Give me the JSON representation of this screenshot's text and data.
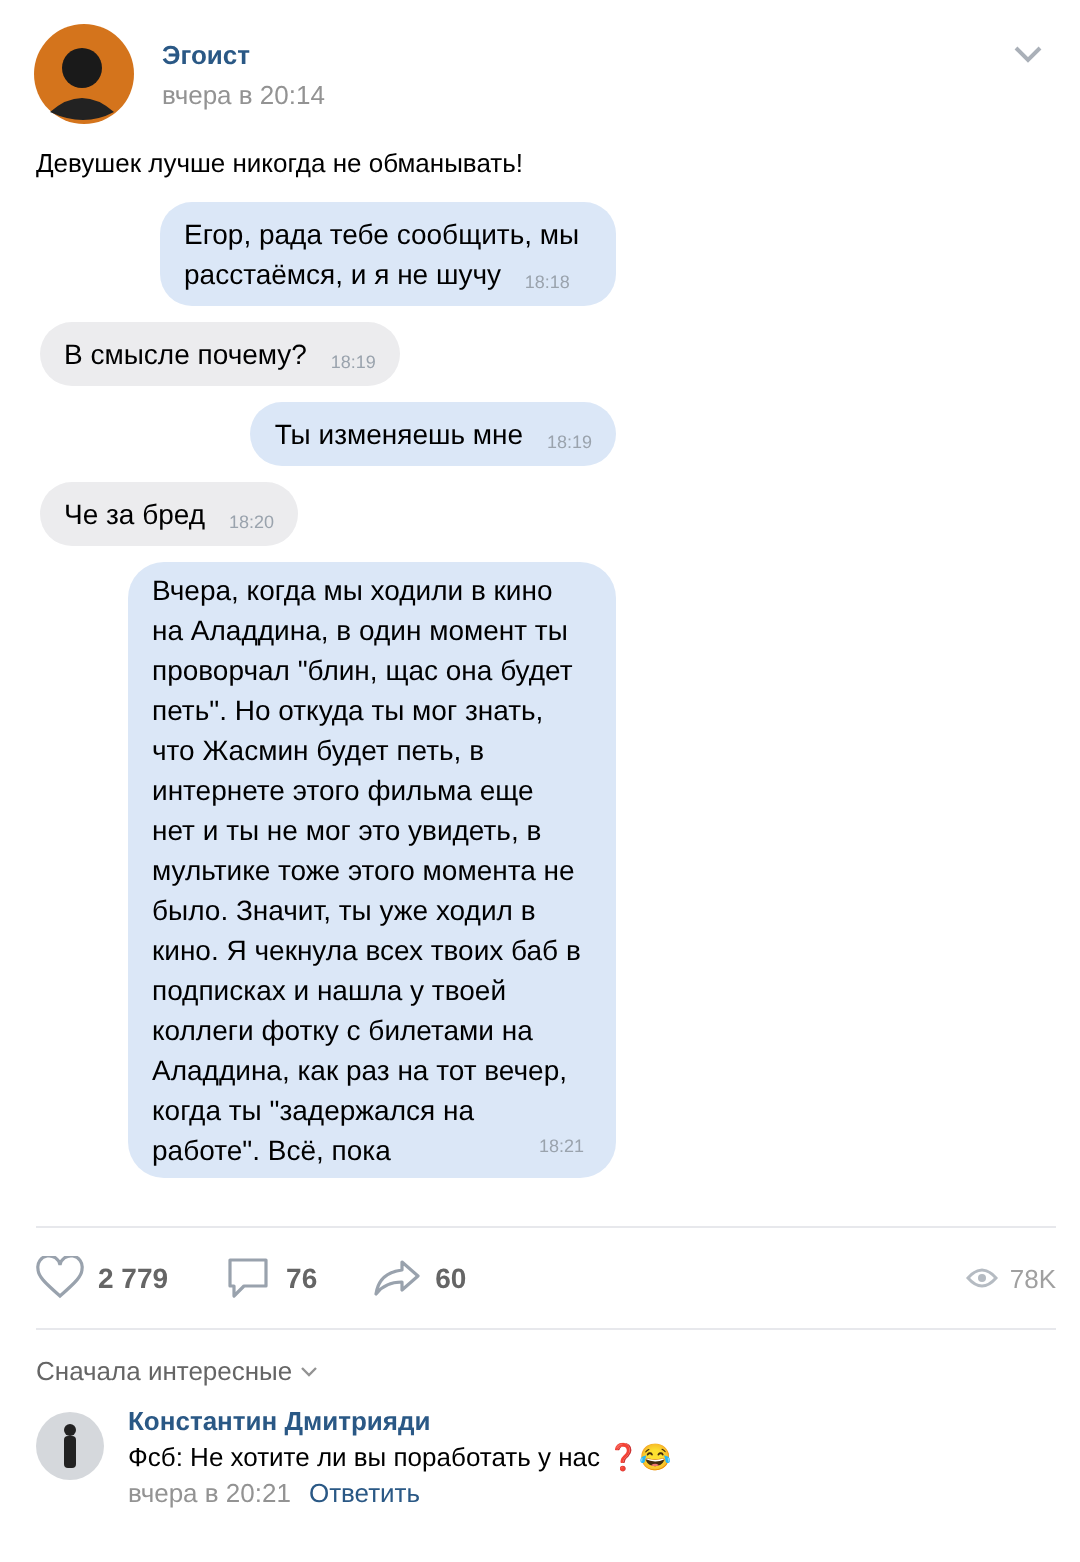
{
  "post": {
    "author": "Эгоист",
    "time": "вчера в 20:14",
    "text": "Девушек лучше никогда не обманывать!"
  },
  "messages": [
    {
      "kind": "out",
      "text": "Егор, рада тебе сообщить, мы расстаёмся, и я не шучу",
      "time": "18:18"
    },
    {
      "kind": "in",
      "text": "В смысле почему?",
      "time": "18:19"
    },
    {
      "kind": "out",
      "text": "Ты изменяешь мне",
      "time": "18:19"
    },
    {
      "kind": "in",
      "text": "Че за бред",
      "time": "18:20"
    },
    {
      "kind": "out",
      "text": "Вчера, когда мы ходили в кино на Аладдина, в один момент ты проворчал \"блин, щас она будет петь\". Но откуда ты мог знать, что Жасмин будет петь, в интернете этого фильма еще нет и ты не мог это увидеть, в мультике тоже этого момента не было. Значит, ты уже ходил в кино. Я чекнула всех твоих баб в подписках и нашла у твоей коллеги фотку с билетами на Аладдина, как раз на тот вечер, когда ты \"задержался на работе\". Всё, пока",
      "time": "18:21"
    }
  ],
  "actions": {
    "likes": "2 779",
    "comments": "76",
    "shares": "60",
    "views": "78K"
  },
  "comments": {
    "sort": "Сначала интересные",
    "items": [
      {
        "author": "Константин Дмитрияди",
        "text": "Фсб: Не хотите ли вы поработать у нас ❓😂",
        "time": "вчера в 20:21",
        "reply": "Ответить"
      }
    ]
  }
}
